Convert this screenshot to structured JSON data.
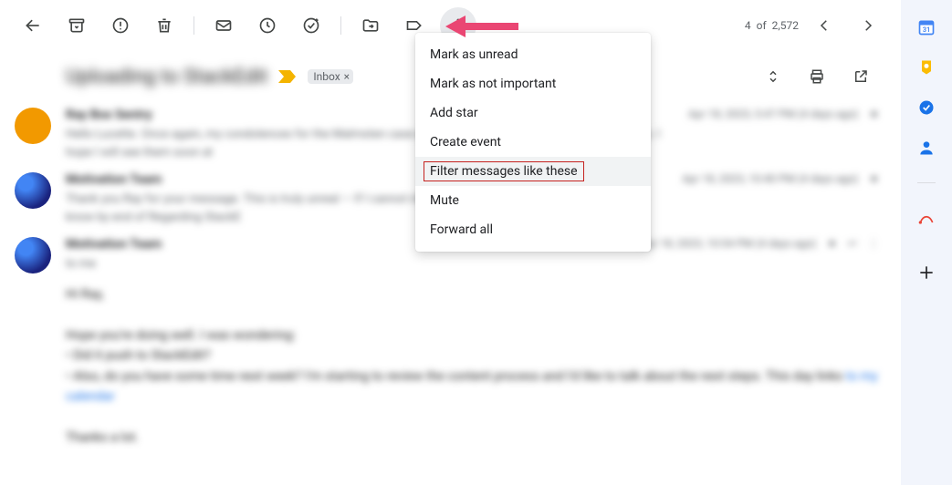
{
  "toolbar": {
    "more_icon": "more-vert"
  },
  "pager": {
    "text_prefix": "4",
    "text_of": "of",
    "text_total": "2,572"
  },
  "subject": {
    "text": "Uploading to StackEdit",
    "inbox_label": "Inbox",
    "inbox_close": "×"
  },
  "dropdown": {
    "items": [
      "Mark as unread",
      "Mark as not important",
      "Add star",
      "Create event",
      "Filter messages like these",
      "Mute",
      "Forward all"
    ],
    "highlight_index": 4
  },
  "messages": [
    {
      "avatar": "av1",
      "sender": "Ray Box Sentry",
      "snippet": "Hello Lucette. Once again, my condolences for the Malmsten case and we hope you are doing better these days. I hope I will see them soon at",
      "meta": "Apr 18, 2023, 5:47 PM (4 days ago)"
    },
    {
      "avatar": "av2",
      "sender": "Motivation Team",
      "snippet": "Thank you Ray for your message. This is truly unreal — If I cannot make the meeting I will let you and Beryllium know by end of Regarding StackE",
      "meta": "Apr 18, 2023, 10:40 PM (4 days ago)"
    }
  ],
  "expanded": {
    "avatar": "av2",
    "sender": "Motivation Team",
    "to": "to me",
    "meta": "Apr 18, 2023, 10:54 PM (4 days ago)",
    "body_lines": [
      "Hi Ray,",
      "",
      "Hope you're doing well. I was wondering:",
      "• Did it push to StackEdit?",
      "• Also, do you have some time next week? I'm starting to review the content process and I'd like to talk about the next steps. This day links",
      "",
      "Thanks a lot."
    ],
    "link_text": "to my calendar"
  },
  "sidepanel": {
    "apps": [
      "calendar",
      "keep",
      "tasks",
      "contacts"
    ],
    "below": [
      "mail-signature"
    ],
    "plus": "+"
  }
}
